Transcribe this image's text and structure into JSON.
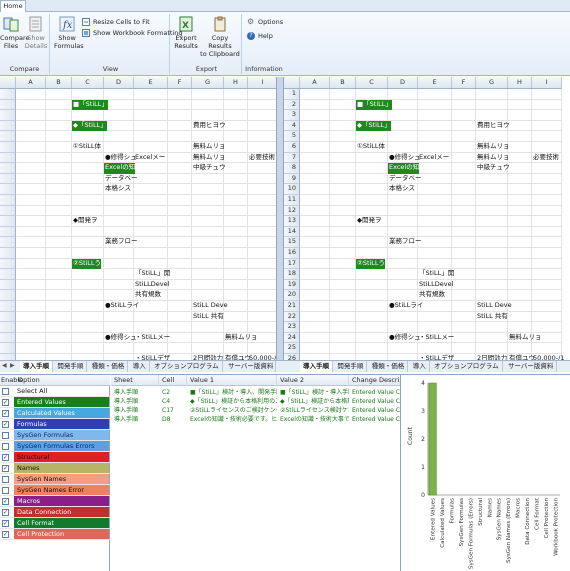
{
  "ribbon": {
    "tab_home": "Home",
    "compare": {
      "label": "Compare",
      "compare_files_line1": "Compare",
      "compare_files_line2": "Files",
      "show_details_line1": "Show",
      "show_details_line2": "Details"
    },
    "view": {
      "label": "View",
      "show_formulas_line1": "Show",
      "show_formulas_line2": "Formulas",
      "resize_cells": "Resize Cells to Fit",
      "show_workbook_formatting": "Show Workbook Formatting"
    },
    "export": {
      "label": "Export",
      "export_results_line1": "Export",
      "export_results_line2": "Results",
      "copy_results_line1": "Copy Results",
      "copy_results_line2": "to Clipboard"
    },
    "information": {
      "label": "Information",
      "options": "Options",
      "help": "Help"
    }
  },
  "sheet": {
    "columns": [
      "A",
      "B",
      "C",
      "D",
      "E",
      "F",
      "G",
      "H",
      "I"
    ],
    "rows_left": [
      "",
      "",
      "",
      "",
      "",
      "",
      "",
      "",
      "",
      "",
      "",
      "",
      "",
      "",
      "",
      "",
      "",
      "",
      "",
      "",
      "",
      "",
      "",
      "",
      "",
      ""
    ],
    "rows_right": [
      "1",
      "2",
      "3",
      "4",
      "5",
      "6",
      "7",
      "8",
      "9",
      "10",
      "11",
      "12",
      "13",
      "14",
      "15",
      "16",
      "17",
      "18",
      "19",
      "20",
      "21",
      "22",
      "23",
      "24",
      "25",
      "26"
    ]
  },
  "cells": {
    "r2_c": "■「StiLL」",
    "r4_c": "◆「StiLL」",
    "r4_g": "費用ヒヨウ",
    "r6_c": "①StiLL体",
    "r6_g": "無料ムリョ",
    "r7_d": "●修得シュ",
    "r7_e": "Excelメー",
    "r7_g": "無料ムリョ",
    "r7_i": "必要技術",
    "r8_d": "Excelの知",
    "r8_g": "中級チュウ",
    "r9_d": "データベー",
    "r10_d": "本格シス",
    "r13_c": "◆開発ヲ",
    "r15_d": "業務フロー",
    "r17_c": "②StiLLう",
    "r18_e": "「StiLL」開",
    "r19_e": "StiLLDevel",
    "r20_e": "共有規数",
    "r21_d": "●StiLLライ",
    "r21_g": "StiLL Deve",
    "r22_g": "StiLL 共有",
    "r24_d": "●修得シュ",
    "r24_e": "・StiLLメー",
    "r24_h": "無料ムリョ",
    "r26_e": "・StiLLデザ",
    "r26_g": "2日間効力",
    "r26_h": "有償ユウ",
    "r26_i": "50,000-/1"
  },
  "sheet_tabs": [
    "導入手順",
    "開発手順",
    "種類・価格",
    "導入",
    "オプションプログラム",
    "サーバー版資料"
  ],
  "sheet_tabs_right": [
    "導入手順",
    "開発手順",
    "種類・価格",
    "導入",
    "オプションプログラム",
    "サーバー版資料"
  ],
  "options": {
    "header_enable": "Enable",
    "header_option": "Option",
    "items": [
      {
        "label": "Select All",
        "checked": false,
        "color": "#ffffff",
        "text_color": "#111111"
      },
      {
        "label": "Entered Values",
        "checked": true,
        "color": "#17801a",
        "text_color": "#ffffff"
      },
      {
        "label": "Calculated Values",
        "checked": true,
        "color": "#46a8e0",
        "text_color": "#ffffff"
      },
      {
        "label": "Formulas",
        "checked": true,
        "color": "#2d3fb3",
        "text_color": "#ffffff"
      },
      {
        "label": "SysGen Formulas",
        "checked": false,
        "color": "#7fb8ea",
        "text_color": "#0d2a66"
      },
      {
        "label": "SysGen Formulas Errors",
        "checked": false,
        "color": "#5f9fe0",
        "text_color": "#0d2a66"
      },
      {
        "label": "Structural",
        "checked": true,
        "color": "#e02020",
        "text_color": "#111111"
      },
      {
        "label": "Names",
        "checked": true,
        "color": "#b7b468",
        "text_color": "#111111"
      },
      {
        "label": "SysGen Names",
        "checked": false,
        "color": "#f0a080",
        "text_color": "#111111"
      },
      {
        "label": "SysGen Names Error",
        "checked": false,
        "color": "#f08060",
        "text_color": "#111111"
      },
      {
        "label": "Macros",
        "checked": true,
        "color": "#8a1f8a",
        "text_color": "#ffffff"
      },
      {
        "label": "Data Connection",
        "checked": true,
        "color": "#c03030",
        "text_color": "#ffffff"
      },
      {
        "label": "Cell Format",
        "checked": true,
        "color": "#127a2a",
        "text_color": "#ffffff"
      },
      {
        "label": "Cell Protection",
        "checked": true,
        "color": "#d96a5a",
        "text_color": "#ffffff"
      }
    ]
  },
  "differences": {
    "headers": [
      "Sheet",
      "Cell",
      "Value 1",
      "Value 2",
      "Change Description"
    ],
    "rows": [
      [
        "導入手順",
        "C2",
        "■「StiLL」検討・導入、開発手順",
        "■「StiLL」検討・導入手順、参...",
        "Entered Value Chan"
      ],
      [
        "導入手順",
        "C4",
        "◆「StiLL」検証から本格利用のステ...",
        "◆「StiLL」検証から本格利用の...",
        "Entered Value Chan"
      ],
      [
        "導入手順",
        "C17",
        "②StiLLライセンスのご検討ケンケ",
        "②StiLLライセンス検討ケンケ",
        "Entered Value Chan"
      ],
      [
        "導入手順",
        "D8",
        "Excelの知識・技術必要です。ヒッス",
        "Excelの知識・技術大事です。",
        "Entered Value Chan"
      ]
    ]
  },
  "chart_data": {
    "type": "bar",
    "ylabel": "Count",
    "ylim": [
      0,
      4
    ],
    "yticks": [
      0,
      1,
      2,
      3,
      4
    ],
    "categories": [
      "Entered Values",
      "Calculated Values",
      "Formulas",
      "SysGen Formulas",
      "SysGen Formulas (Errors)",
      "Structural",
      "Names",
      "SysGen Names",
      "SysGen Names (Errors)",
      "Macros",
      "Data Connection",
      "Cell Format",
      "Cell Protection",
      "Workbook Protection"
    ],
    "values": [
      4,
      0,
      0,
      0,
      0,
      0,
      0,
      0,
      0,
      0,
      0,
      0,
      0,
      0
    ],
    "bar_color": "#7bb24a"
  }
}
